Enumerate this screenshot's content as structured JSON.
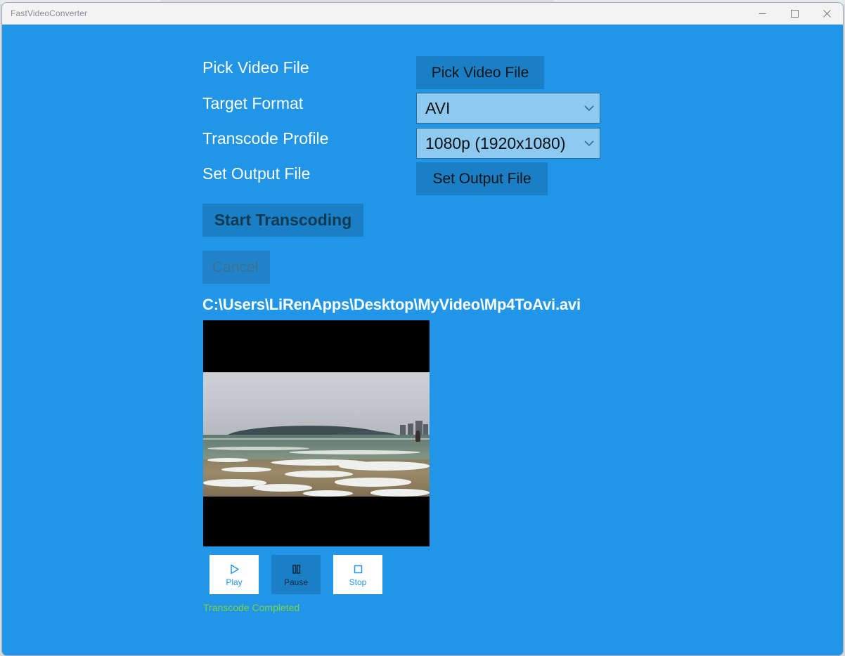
{
  "window": {
    "title": "FastVideoConverter",
    "controls": {
      "minimize": "minimize-button",
      "maximize": "maximize-button",
      "close": "close-button"
    }
  },
  "colors": {
    "background": "#2196e8",
    "button": "#1a7fc4",
    "combobox": "#8ec9ef",
    "combobox_border": "#2a6d95",
    "label_text": "#ffffff",
    "button_text": "#111418",
    "status_success": "#7fd13b",
    "titlebar": "#f3f3f3",
    "titlebar_text": "#8a8d93",
    "media_button_accent": "#2196e8"
  },
  "form": {
    "rows": [
      {
        "label": "Pick Video File",
        "control": "button",
        "value": "Pick Video File"
      },
      {
        "label": "Target Format",
        "control": "combobox",
        "value": "AVI"
      },
      {
        "label": "Transcode Profile",
        "control": "combobox",
        "value": "1080p (1920x1080)"
      },
      {
        "label": "Set Output File",
        "control": "button",
        "value": "Set Output File"
      }
    ],
    "actions": {
      "start_label": "Start Transcoding",
      "cancel_label": "Cancel"
    }
  },
  "output": {
    "path": "C:\\Users\\LiRenApps\\Desktop\\MyVideo\\Mp4ToAvi.avi"
  },
  "preview": {
    "description": "beach-ocean-video-frame"
  },
  "media_controls": [
    {
      "label": "Play",
      "icon": "play-icon",
      "state": "enabled"
    },
    {
      "label": "Pause",
      "icon": "pause-icon",
      "state": "active"
    },
    {
      "label": "Stop",
      "icon": "stop-icon",
      "state": "enabled"
    }
  ],
  "status": {
    "text": "Transcode Completed"
  },
  "icons": {
    "chevron_down": "chevron-down-icon",
    "minimize": "minimize-icon",
    "maximize": "maximize-icon",
    "close": "close-icon"
  }
}
